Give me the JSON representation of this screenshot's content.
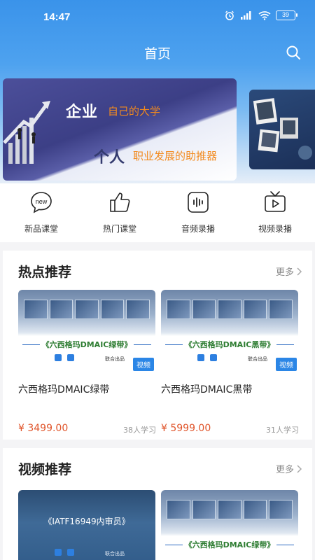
{
  "status_bar": {
    "time": "14:47",
    "battery": "39"
  },
  "header": {
    "title": "首页"
  },
  "banner": {
    "line1_main": "企业",
    "line1_sub": "自己的大学",
    "line2_main": "个人",
    "line2_sub": "职业发展的助推器"
  },
  "quick_entries": [
    {
      "label": "新品课堂",
      "icon": "new-badge-icon",
      "icon_text": "new"
    },
    {
      "label": "热门课堂",
      "icon": "thumbs-up-icon"
    },
    {
      "label": "音频录播",
      "icon": "audio-wave-icon"
    },
    {
      "label": "视频录播",
      "icon": "tv-play-icon"
    }
  ],
  "hot": {
    "title": "热点推荐",
    "more": "更多",
    "cards": [
      {
        "thumb_caption": "《六西格玛DMAIC绿带》",
        "thumb_joint": "联合出品",
        "tag": "视频",
        "name": "六西格玛DMAIC绿带",
        "price": "¥ 3499.00",
        "learners": "38人学习"
      },
      {
        "thumb_caption": "《六西格玛DMAIC黑带》",
        "thumb_joint": "联合出品",
        "tag": "视频",
        "name": "六西格玛DMAIC黑带",
        "price": "¥ 5999.00",
        "learners": "31人学习"
      }
    ]
  },
  "video": {
    "title": "视频推荐",
    "more": "更多",
    "cards": [
      {
        "thumb_caption": "《IATF16949内审员》",
        "thumb_joint": "联合出品"
      },
      {
        "thumb_caption": "《六西格玛DMAIC绿带》"
      }
    ]
  },
  "colors": {
    "primary": "#3a93ea",
    "price": "#e0552b",
    "tag": "#2b86e6"
  }
}
